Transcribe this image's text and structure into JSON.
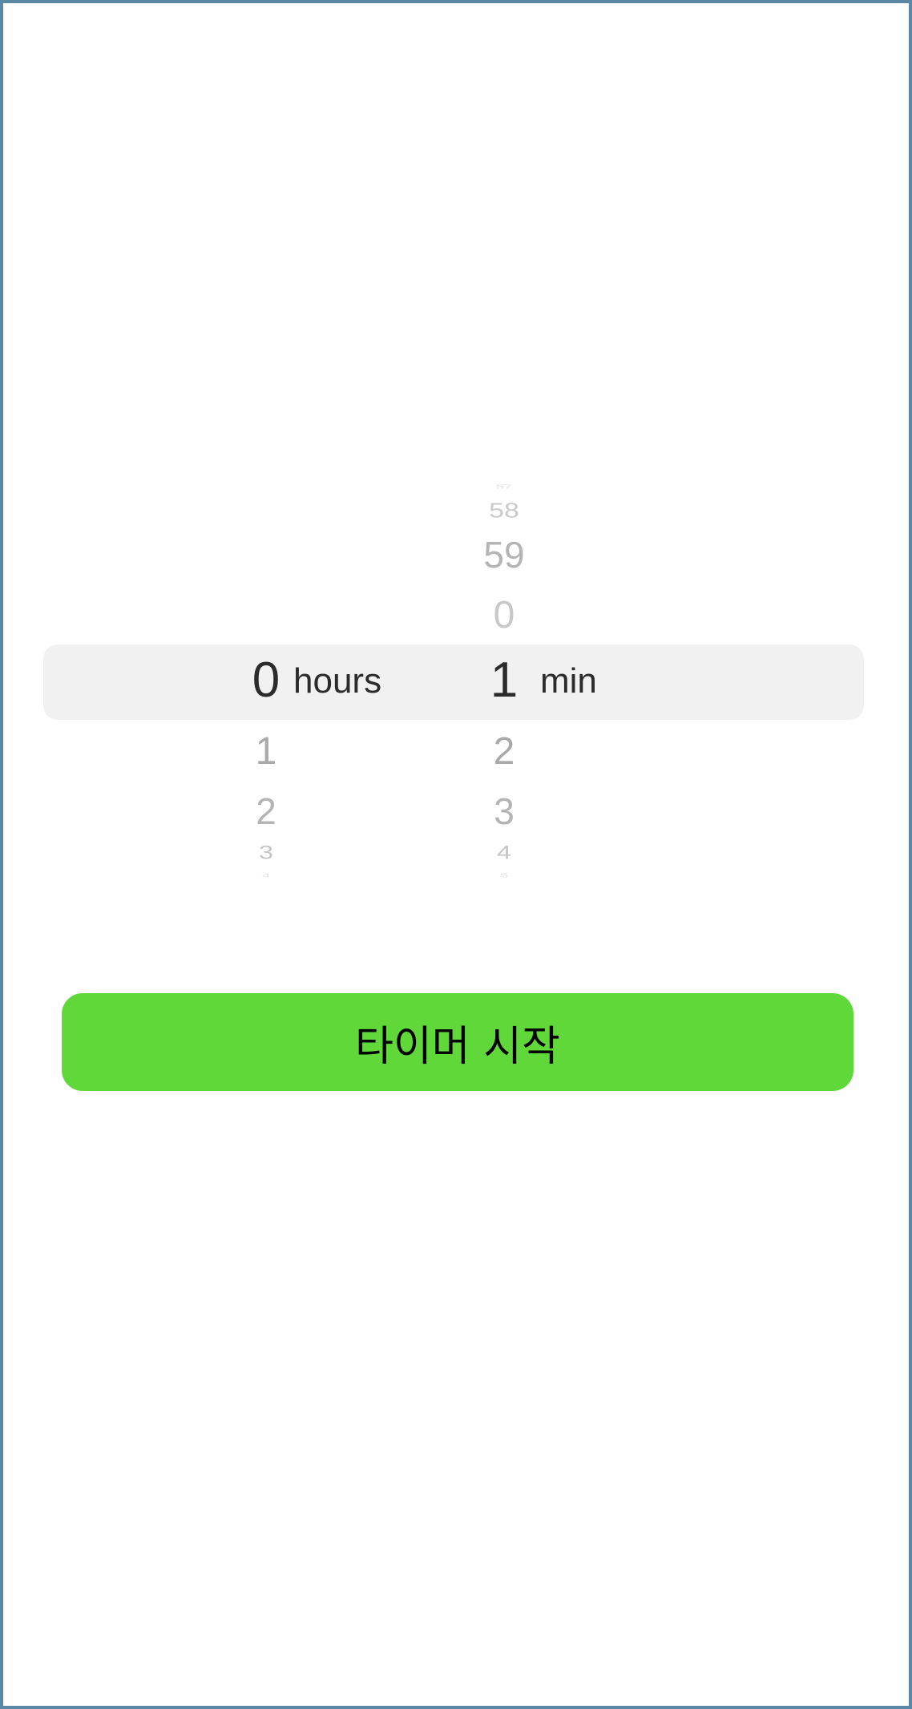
{
  "picker": {
    "hours": {
      "selected": "0",
      "unit": "hours",
      "after": [
        "1",
        "2",
        "3",
        "4"
      ]
    },
    "minutes": {
      "before": [
        "57",
        "58",
        "59",
        "0"
      ],
      "selected": "1",
      "unit": "min",
      "after": [
        "2",
        "3",
        "4",
        "5"
      ]
    }
  },
  "start_button": {
    "label": "타이머 시작"
  },
  "colors": {
    "button": "#61d83a",
    "selection_band": "#f1f1f1",
    "frame_border": "#5b88a6"
  }
}
